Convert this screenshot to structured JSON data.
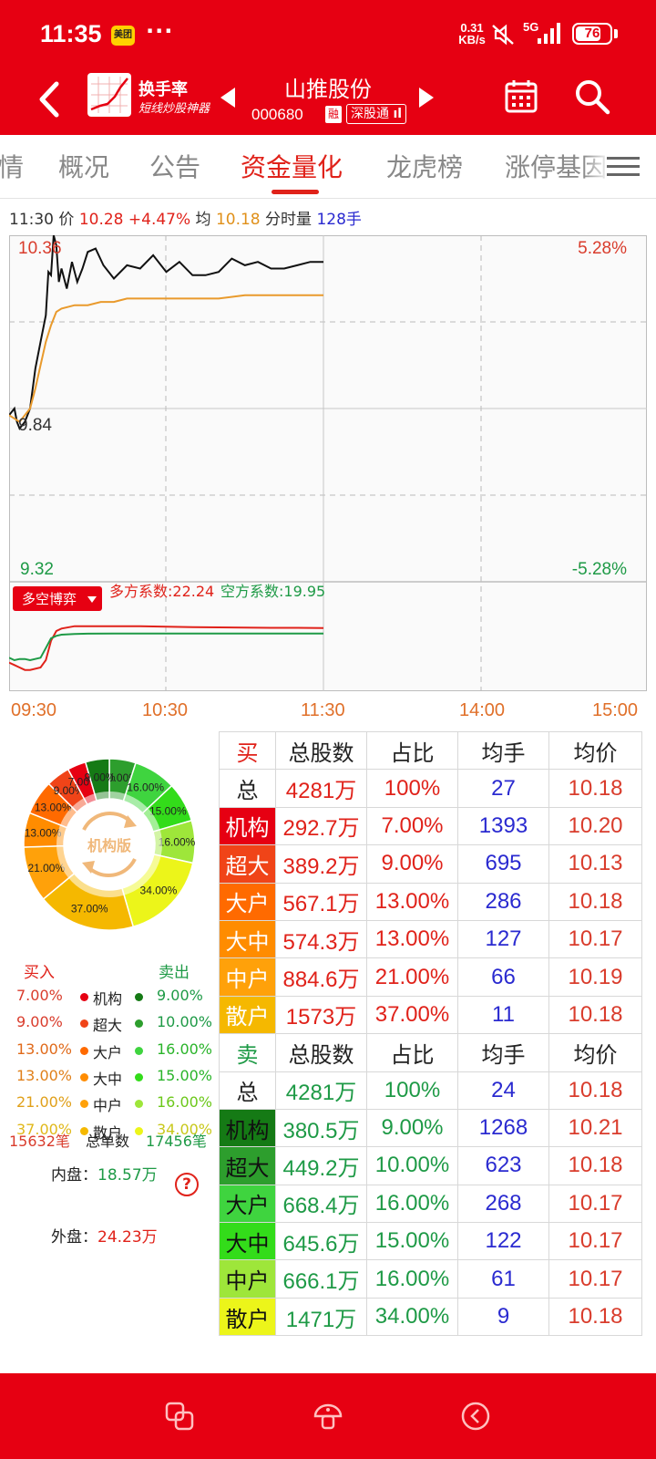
{
  "status_bar": {
    "time": "11:35",
    "app_badge": "美团",
    "more": "···",
    "net_speed_value": "0.31",
    "net_speed_unit": "KB/s",
    "network_type": "5G",
    "battery": "76",
    "battery_level": 0.76
  },
  "nav": {
    "logo_title": "换手率",
    "logo_subtitle": "短线炒股神器",
    "stock_name": "山推股份",
    "stock_code": "000680",
    "rong_badge": "融",
    "connect_badge": "深股通"
  },
  "tabs": [
    {
      "label": "情",
      "active": false
    },
    {
      "label": "概况",
      "active": false
    },
    {
      "label": "公告",
      "active": false
    },
    {
      "label": "资金量化",
      "active": true
    },
    {
      "label": "龙虎榜",
      "active": false
    },
    {
      "label": "涨停基因",
      "active": false
    }
  ],
  "info_line": {
    "time": "11:30",
    "price_label": "价",
    "price": "10.28",
    "change": "+4.47%",
    "avg_label": "均",
    "avg": "10.18",
    "vol_label": "分时量",
    "vol": "128手"
  },
  "chart_data": {
    "type": "line",
    "price_axis": {
      "max": "10.36",
      "mid": "9.84",
      "min": "9.32",
      "max_pct": "5.28%",
      "min_pct": "-5.28%",
      "ylim": [
        9.32,
        10.36
      ]
    },
    "time_ticks": [
      "09:30",
      "10:30",
      "11:30",
      "14:00",
      "15:00"
    ],
    "series": [
      {
        "key": "price",
        "color": "#111111",
        "x": [
          0,
          2,
          3,
          4,
          6,
          8,
          10,
          12,
          14,
          15,
          16,
          17,
          18,
          19,
          20,
          22,
          24,
          26,
          28,
          30,
          33,
          36,
          40,
          45,
          50,
          55,
          60,
          65,
          70,
          75,
          80,
          85,
          90,
          95,
          100,
          105,
          110,
          115,
          120
        ],
        "y": [
          9.82,
          9.84,
          9.8,
          9.78,
          9.8,
          9.84,
          9.96,
          10.04,
          10.12,
          10.25,
          10.24,
          10.36,
          10.33,
          10.22,
          10.26,
          10.2,
          10.28,
          10.22,
          10.26,
          10.31,
          10.32,
          10.27,
          10.23,
          10.27,
          10.26,
          10.3,
          10.25,
          10.28,
          10.24,
          10.24,
          10.25,
          10.29,
          10.27,
          10.28,
          10.26,
          10.26,
          10.27,
          10.28,
          10.28
        ]
      },
      {
        "key": "average",
        "color": "#e99a2c",
        "x": [
          0,
          4,
          8,
          10,
          12,
          14,
          16,
          18,
          20,
          25,
          30,
          35,
          40,
          45,
          50,
          60,
          70,
          80,
          90,
          100,
          110,
          120
        ],
        "y": [
          9.82,
          9.8,
          9.84,
          9.9,
          9.97,
          10.04,
          10.09,
          10.13,
          10.14,
          10.15,
          10.15,
          10.16,
          10.16,
          10.17,
          10.17,
          10.17,
          10.17,
          10.17,
          10.18,
          10.18,
          10.18,
          10.18
        ]
      }
    ],
    "sub_panel": {
      "selector_label": "多空博弈",
      "bull_label": "多方系数:22.24",
      "bear_label": "空方系数:19.95",
      "ylim": [
        0,
        30
      ],
      "series": [
        {
          "key": "bull",
          "color": "#e0221a",
          "x": [
            0,
            2,
            4,
            6,
            8,
            12,
            14,
            16,
            18,
            20,
            25,
            30,
            40,
            50,
            60,
            70,
            80,
            90,
            100,
            110,
            120
          ],
          "y": [
            8,
            7,
            6,
            5,
            5,
            6,
            9,
            17,
            21,
            22,
            23,
            23,
            23,
            23,
            22.8,
            22.6,
            22.5,
            22.4,
            22.3,
            22.3,
            22.24
          ]
        },
        {
          "key": "bear",
          "color": "#1e9a46",
          "x": [
            0,
            2,
            4,
            6,
            8,
            12,
            14,
            16,
            18,
            20,
            25,
            30,
            40,
            50,
            60,
            70,
            80,
            90,
            100,
            110,
            120
          ],
          "y": [
            10,
            9,
            9.5,
            9.5,
            9,
            10,
            14,
            18,
            19,
            19.5,
            19.8,
            19.9,
            20,
            20,
            20,
            20,
            19.95,
            19.95,
            19.95,
            19.95,
            19.95
          ]
        }
      ]
    }
  },
  "donut": {
    "center_label": "机构版",
    "slices": [
      {
        "label": "10.00%",
        "value": 10.0,
        "color": "#2d9e2d"
      },
      {
        "label": "16.00%",
        "value": 16.0,
        "color": "#3fd43f"
      },
      {
        "label": "15.00%",
        "value": 15.0,
        "color": "#33dc1a"
      },
      {
        "label": "16.00%",
        "value": 16.0,
        "color": "#9ee63a"
      },
      {
        "label": "34.00%",
        "value": 34.0,
        "color": "#ecf51a"
      },
      {
        "label": "37.00%",
        "value": 37.0,
        "color": "#f5b800"
      },
      {
        "label": "21.00%",
        "value": 21.0,
        "color": "#ffa10a"
      },
      {
        "label": "13.00%",
        "value": 13.0,
        "color": "#ff8c00"
      },
      {
        "label": "13.00%",
        "value": 13.0,
        "color": "#ff6a00"
      },
      {
        "label": "9.00%",
        "value": 9.0,
        "color": "#f04418"
      },
      {
        "label": "7.00%",
        "value": 7.0,
        "color": "#e60012"
      },
      {
        "label": "9.00%",
        "value": 9.0,
        "color": "#157a15"
      }
    ]
  },
  "legend": {
    "buy_title": "买入",
    "sell_title": "卖出",
    "rows": [
      {
        "buy": "7.00%",
        "name": "机构",
        "sell": "9.00%",
        "buy_color": "#e60012",
        "sell_color": "#157a15"
      },
      {
        "buy": "9.00%",
        "name": "超大",
        "sell": "10.00%",
        "buy_color": "#f04418",
        "sell_color": "#2d9e2d"
      },
      {
        "buy": "13.00%",
        "name": "大户",
        "sell": "16.00%",
        "buy_color": "#ff6a00",
        "sell_color": "#3fd43f"
      },
      {
        "buy": "13.00%",
        "name": "大中",
        "sell": "15.00%",
        "buy_color": "#ff8c00",
        "sell_color": "#33dc1a"
      },
      {
        "buy": "21.00%",
        "name": "中户",
        "sell": "16.00%",
        "buy_color": "#ffa10a",
        "sell_color": "#9ee63a"
      },
      {
        "buy": "37.00%",
        "name": "散户",
        "sell": "34.00%",
        "buy_color": "#f5b800",
        "sell_color": "#ecf51a"
      }
    ],
    "total_buy": "15632笔",
    "total_label": "总单数",
    "total_sell": "17456笔",
    "inner_label": "内盘：",
    "inner_value": "18.57万",
    "outer_label": "外盘：",
    "outer_value": "24.23万",
    "help": "?"
  },
  "buy_table": {
    "side": "买",
    "headers": [
      "总股数",
      "占比",
      "均手",
      "均价"
    ],
    "rows": [
      {
        "cat": "总",
        "shares": "4281万",
        "pct": "100%",
        "avg_lot": "27",
        "avg_price": "10.18",
        "color": ""
      },
      {
        "cat": "机构",
        "shares": "292.7万",
        "pct": "7.00%",
        "avg_lot": "1393",
        "avg_price": "10.20",
        "color": "#e60012"
      },
      {
        "cat": "超大",
        "shares": "389.2万",
        "pct": "9.00%",
        "avg_lot": "695",
        "avg_price": "10.13",
        "color": "#f04418"
      },
      {
        "cat": "大户",
        "shares": "567.1万",
        "pct": "13.00%",
        "avg_lot": "286",
        "avg_price": "10.18",
        "color": "#ff6a00"
      },
      {
        "cat": "大中",
        "shares": "574.3万",
        "pct": "13.00%",
        "avg_lot": "127",
        "avg_price": "10.17",
        "color": "#ff8c00"
      },
      {
        "cat": "中户",
        "shares": "884.6万",
        "pct": "21.00%",
        "avg_lot": "66",
        "avg_price": "10.19",
        "color": "#ffa10a"
      },
      {
        "cat": "散户",
        "shares": "1573万",
        "pct": "37.00%",
        "avg_lot": "11",
        "avg_price": "10.18",
        "color": "#f5b800"
      }
    ]
  },
  "sell_table": {
    "side": "卖",
    "headers": [
      "总股数",
      "占比",
      "均手",
      "均价"
    ],
    "rows": [
      {
        "cat": "总",
        "shares": "4281万",
        "pct": "100%",
        "avg_lot": "24",
        "avg_price": "10.18",
        "color": ""
      },
      {
        "cat": "机构",
        "shares": "380.5万",
        "pct": "9.00%",
        "avg_lot": "1268",
        "avg_price": "10.21",
        "color": "#157a15"
      },
      {
        "cat": "超大",
        "shares": "449.2万",
        "pct": "10.00%",
        "avg_lot": "623",
        "avg_price": "10.18",
        "color": "#2d9e2d"
      },
      {
        "cat": "大户",
        "shares": "668.4万",
        "pct": "16.00%",
        "avg_lot": "268",
        "avg_price": "10.17",
        "color": "#3fd43f"
      },
      {
        "cat": "大中",
        "shares": "645.6万",
        "pct": "15.00%",
        "avg_lot": "122",
        "avg_price": "10.17",
        "color": "#33dc1a"
      },
      {
        "cat": "中户",
        "shares": "666.1万",
        "pct": "16.00%",
        "avg_lot": "61",
        "avg_price": "10.17",
        "color": "#9ee63a"
      },
      {
        "cat": "散户",
        "shares": "1471万",
        "pct": "34.00%",
        "avg_lot": "9",
        "avg_price": "10.18",
        "color": "#ecf51a"
      }
    ]
  },
  "colors": {
    "brand_red": "#e60012",
    "up_red": "#e0221a",
    "down_green": "#1e9a46",
    "avg_orange": "#e99a2c",
    "lot_blue": "#2a2ad0"
  },
  "bottom_bar": {
    "icons": [
      "copy-icon",
      "mushroom-icon",
      "back-circle-icon"
    ]
  }
}
